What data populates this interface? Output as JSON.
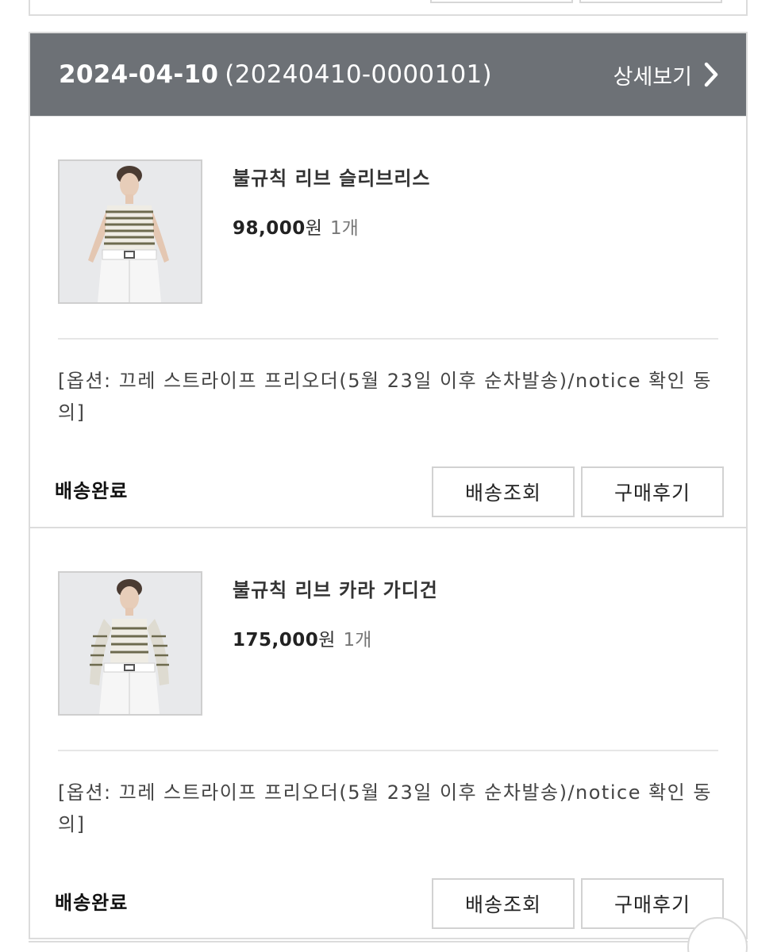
{
  "order": {
    "date": "2024-04-10",
    "order_number": "(20240410-0000101)",
    "detail_label": "상세보기"
  },
  "items": [
    {
      "name": "불규칙 리브 슬리브리스",
      "price": "98,000",
      "currency": "원",
      "quantity": "1개",
      "option": "[옵션: 끄레 스트라이프 프리오더(5월 23일 이후 순차발송)/notice 확인 동의]",
      "status": "배송완료",
      "track_label": "배송조회",
      "review_label": "구매후기"
    },
    {
      "name": "불규칙 리브 카라 가디건",
      "price": "175,000",
      "currency": "원",
      "quantity": "1개",
      "option": "[옵션: 끄레 스트라이프 프리오더(5월 23일 이후 순차발송)/notice 확인 동의]",
      "status": "배송완료",
      "track_label": "배송조회",
      "review_label": "구매후기"
    }
  ],
  "colors": {
    "header_bg": "#6d7176",
    "border": "#dcdcdc"
  }
}
